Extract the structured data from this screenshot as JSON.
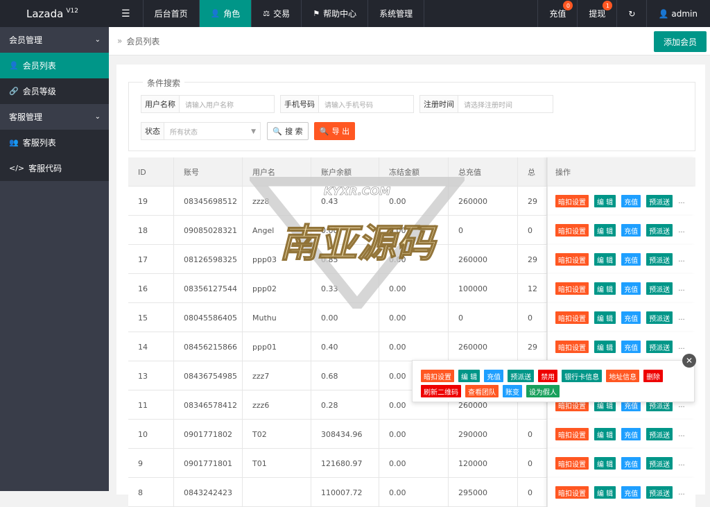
{
  "header": {
    "logo": "Lazada",
    "version": "V12",
    "menu_icon": "menu-icon",
    "nav": [
      {
        "label": "后台首页",
        "icon": ""
      },
      {
        "label": "角色",
        "icon": "user-icon"
      },
      {
        "label": "交易",
        "icon": "scale-icon"
      },
      {
        "label": "帮助中心",
        "icon": "flag-icon"
      },
      {
        "label": "系统管理",
        "icon": ""
      }
    ],
    "right": [
      {
        "label": "充值",
        "badge": "0"
      },
      {
        "label": "提现",
        "badge": "1"
      }
    ],
    "user": "admin"
  },
  "sidebar": {
    "groups": [
      {
        "label": "会员管理",
        "items": [
          {
            "label": "会员列表",
            "icon": "user-icon"
          },
          {
            "label": "会员等级",
            "icon": "link-icon"
          }
        ]
      },
      {
        "label": "客服管理",
        "items": [
          {
            "label": "客服列表",
            "icon": "users-icon"
          },
          {
            "label": "客服代码",
            "icon": "code-icon"
          }
        ]
      }
    ]
  },
  "breadcrumb": "会员列表",
  "add_button": "添加会员",
  "search": {
    "legend": "条件搜索",
    "username": {
      "label": "用户名称",
      "placeholder": "请输入用户名称"
    },
    "phone": {
      "label": "手机号码",
      "placeholder": "请输入手机号码"
    },
    "regtime": {
      "label": "注册时间",
      "placeholder": "请选择注册时间"
    },
    "status": {
      "label": "状态",
      "value": "所有状态"
    },
    "search_btn": "搜 索",
    "export_btn": "导 出"
  },
  "table": {
    "columns": [
      "ID",
      "账号",
      "用户名",
      "账户余额",
      "冻结金额",
      "总充值",
      "总",
      "操作"
    ],
    "rows": [
      [
        "19",
        "08345698512",
        "zzz8",
        "0.43",
        "0.00",
        "260000",
        "29"
      ],
      [
        "18",
        "09085028321",
        "Angel",
        "0.00",
        "0.00",
        "0",
        "0"
      ],
      [
        "17",
        "08126598325",
        "ppp03",
        "0.85",
        "0.00",
        "260000",
        "29"
      ],
      [
        "16",
        "08356127544",
        "ppp02",
        "0.33",
        "0.00",
        "100000",
        "12"
      ],
      [
        "15",
        "08045586405",
        "Muthu",
        "0.00",
        "0.00",
        "0",
        "0"
      ],
      [
        "14",
        "08456215866",
        "ppp01",
        "0.40",
        "0.00",
        "260000",
        "29"
      ],
      [
        "13",
        "08436754985",
        "zzz7",
        "0.68",
        "0.00",
        "",
        ""
      ],
      [
        "11",
        "08346578412",
        "zzz6",
        "0.28",
        "0.00",
        "260000",
        ""
      ],
      [
        "10",
        "0901771802",
        "T02",
        "308434.96",
        "0.00",
        "290000",
        "0"
      ],
      [
        "9",
        "0901771801",
        "T01",
        "121680.97",
        "0.00",
        "120000",
        "0"
      ],
      [
        "8",
        "0843242423",
        "",
        "110007.72",
        "0.00",
        "295000",
        "0"
      ]
    ],
    "ops": [
      "暗扣设置",
      "编 辑",
      "充值",
      "预派送"
    ],
    "more": "..."
  },
  "popup": {
    "buttons": [
      {
        "label": "暗扣设置",
        "color": "o"
      },
      {
        "label": "编 辑",
        "color": "g"
      },
      {
        "label": "充值",
        "color": "b"
      },
      {
        "label": "预派送",
        "color": "g"
      },
      {
        "label": "禁用",
        "color": "r"
      },
      {
        "label": "银行卡信息",
        "color": "g"
      },
      {
        "label": "地址信息",
        "color": "o"
      },
      {
        "label": "删除",
        "color": "r"
      },
      {
        "label": "刷新二维码",
        "color": "r"
      },
      {
        "label": "查看团队",
        "color": "o"
      },
      {
        "label": "账变",
        "color": "b"
      },
      {
        "label": "设为假人",
        "color": "dg"
      }
    ]
  },
  "watermark": {
    "top": "KYXR.COM",
    "main": "南亚源码"
  },
  "colors": {
    "primary": "#009688",
    "orange": "#ff5722",
    "blue": "#1e9fff",
    "red": "#ee0000",
    "dark": "#23262e"
  }
}
